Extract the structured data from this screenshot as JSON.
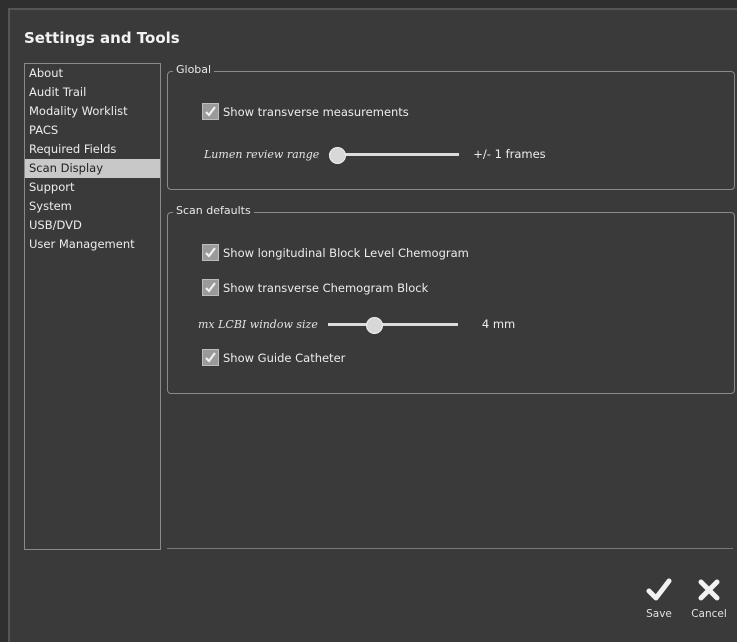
{
  "dialog": {
    "title": "Settings and Tools"
  },
  "sidebar": {
    "items": [
      {
        "label": "About"
      },
      {
        "label": "Audit Trail"
      },
      {
        "label": "Modality Worklist"
      },
      {
        "label": "PACS"
      },
      {
        "label": "Required Fields"
      },
      {
        "label": "Scan Display",
        "selected": true
      },
      {
        "label": "Support"
      },
      {
        "label": "System"
      },
      {
        "label": "USB/DVD"
      },
      {
        "label": "User Management"
      }
    ]
  },
  "global": {
    "title": "Global",
    "show_transverse_measurements": {
      "label": "Show transverse measurements",
      "checked": true
    },
    "lumen_review_range": {
      "label": "Lumen review range",
      "value_text": "+/- 1 frames",
      "level": 0.0
    }
  },
  "scan_defaults": {
    "title": "Scan defaults",
    "show_longitudinal_block": {
      "label": "Show longitudinal Block Level Chemogram",
      "checked": true
    },
    "show_transverse_block": {
      "label": "Show transverse Chemogram Block",
      "checked": true
    },
    "lcbi_window_size": {
      "label": "mx LCBI window size",
      "value_text": "4 mm",
      "level": 0.33
    },
    "show_guide_catheter": {
      "label": "Show Guide Catheter",
      "checked": true
    }
  },
  "actions": {
    "save_label": "Save",
    "cancel_label": "Cancel"
  },
  "colors": {
    "background": "#3a3a3a",
    "selected_item": "#c8c8c8",
    "border": "#8a8a8a"
  },
  "icons": {
    "save": "checkmark-icon",
    "cancel": "x-icon",
    "checkbox": "checkmark-icon"
  }
}
